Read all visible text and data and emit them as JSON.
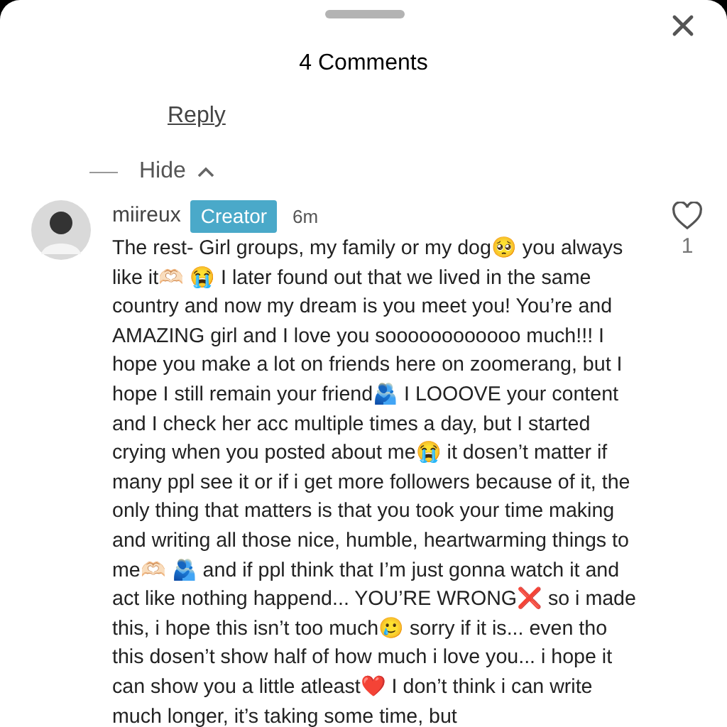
{
  "sheet": {
    "title": "4 Comments"
  },
  "reply_link": "Reply",
  "replies_toggle": {
    "label": "Hide",
    "expanded": true
  },
  "comment": {
    "username": "miireux",
    "badge": "Creator",
    "time": "6m",
    "liked": false,
    "like_count": "1",
    "text": "The rest- Girl groups, my family or my dog🥺 you always like it🫶🏻 😭 I later found out that we lived in the same country and now my dream is you meet you! You’re and AMAZING girl and I love you soooooooooooo much!!! I hope you make a lot on friends here on zoomerang, but I hope I still remain your friend🫂 I LOOOVE your content and I check her acc multiple times a day, but I started crying when you posted about me😭 it dosen’t matter if many ppl see it or if i get more followers because of it, the only thing that matters is that you took your time making and writing all those nice, humble, heartwarming things to me🫶🏻 🫂 and if ppl think that I’m just gonna watch it and act like nothing happend... YOU’RE WRONG❌ so i made this, i hope this isn’t too much🥲 sorry if it is... even tho this dosen’t show half of how much i love you... i hope it can show you a little atleast❤️ I don’t think i can write much longer, it’s taking some time, but"
  }
}
